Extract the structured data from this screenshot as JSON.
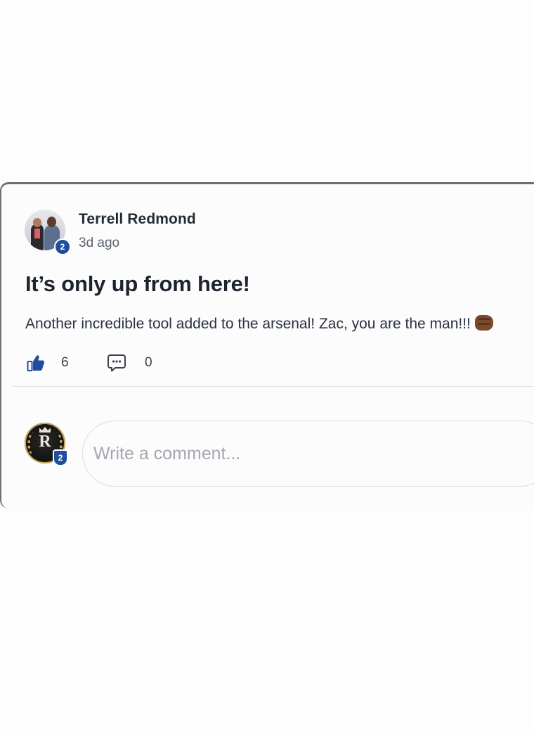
{
  "post": {
    "author": {
      "name": "Terrell Redmond",
      "level": "2",
      "avatar_icon": "author-photo-avatar"
    },
    "time": "3d ago",
    "title": "It’s only up from here!",
    "body": "Another incredible tool added to the arsenal! Zac, you are the man!!!",
    "body_emoji": "fist-bump-emoji",
    "actions": {
      "like_icon": "thumbs-up-icon",
      "like_count": "6",
      "comment_icon": "comment-bubble-icon",
      "comment_count": "0"
    }
  },
  "composer": {
    "viewer_level": "2",
    "viewer_avatar_icon": "crest-monogram-avatar",
    "placeholder": "Write a comment..."
  },
  "colors": {
    "accent": "#1f4e9c",
    "text_primary": "#1d2430",
    "text_secondary": "#5d646e",
    "card_border": "#6b7177"
  }
}
